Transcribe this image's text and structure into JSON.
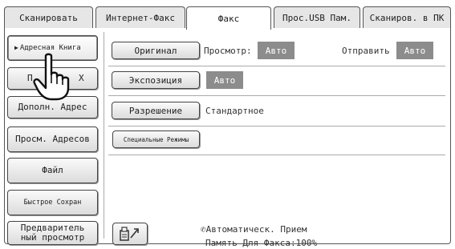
{
  "tabs": [
    {
      "label": "Сканировать"
    },
    {
      "label": "Интернет-Факс"
    },
    {
      "label": "Факс"
    },
    {
      "label": "Прос.USB Пам."
    },
    {
      "label": "Сканиров. в ПК"
    }
  ],
  "left_buttons": {
    "address_book": "Адресная Книга",
    "direct_entry_visible": "П",
    "direct_entry_suffix": "Х",
    "additional_address": "Дополн. Адрес",
    "view_addresses": "Просм. Адресов",
    "file": "Файл",
    "quick_save": "Быстрое Сохран",
    "preview": "Предваритель ный просмотр"
  },
  "settings": {
    "original_button": "Оригинал",
    "view_label": "Просмотр:",
    "view_value": "Авто",
    "send_label": "Отправить",
    "send_value": "Авто",
    "exposure_button": "Экспозиция",
    "exposure_value": "Авто",
    "resolution_button": "Разрешение",
    "resolution_value": "Стандартное",
    "special_modes_button": "Специальные Режимы"
  },
  "status": {
    "receive_mode": "Автоматическ. Прием",
    "fax_memory": "Память Для Факса:100%"
  },
  "icons": {
    "pointer": "hand-pointer-icon",
    "triangle": "right-triangle-icon",
    "phone": "phone-icon",
    "export": "fax-export-icon"
  }
}
